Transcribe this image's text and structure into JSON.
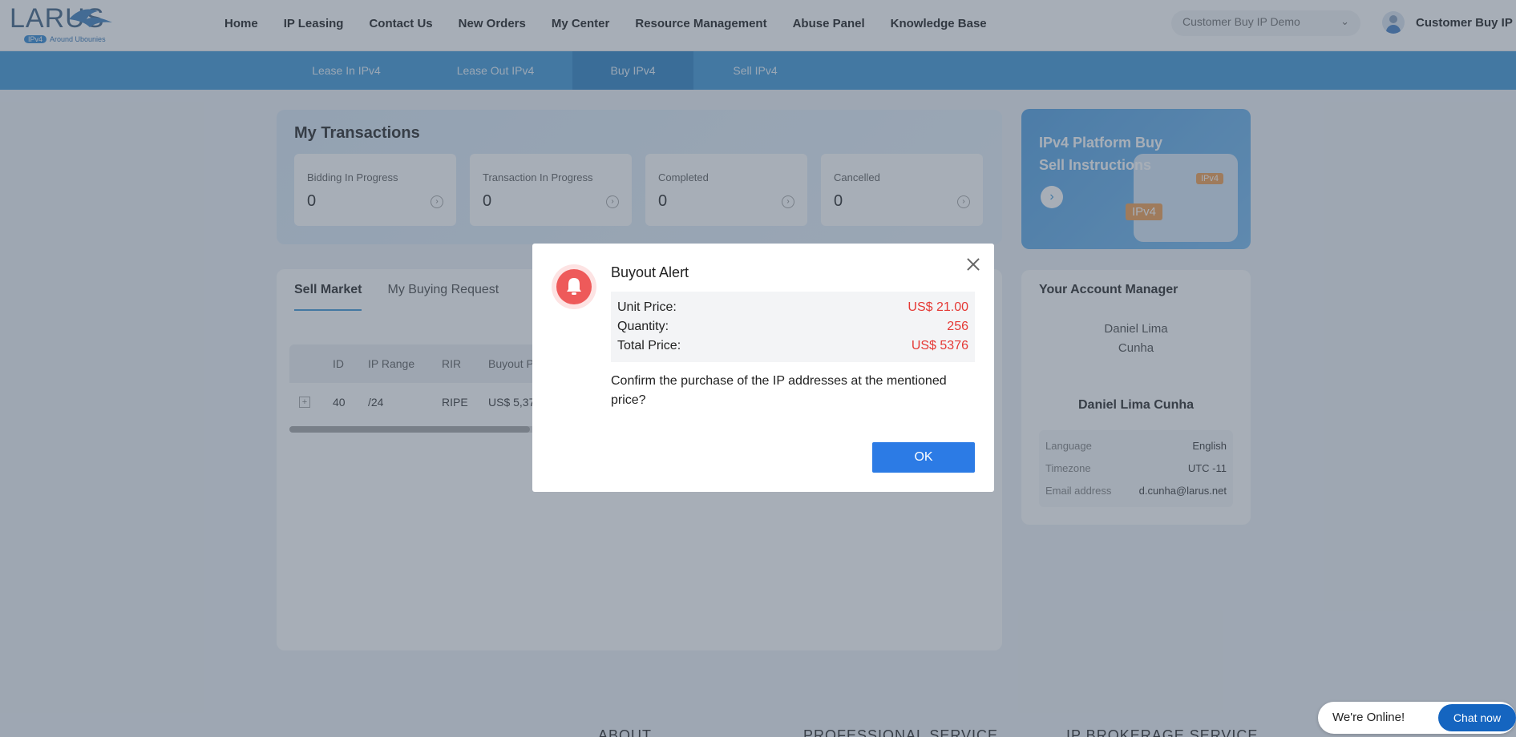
{
  "logo": {
    "text": "LARUS",
    "tag_badge": "IPv4",
    "tag_text": "Around Ubounies"
  },
  "nav": {
    "items": [
      "Home",
      "IP Leasing",
      "Contact Us",
      "New Orders",
      "My Center",
      "Resource Management",
      "Abuse Panel",
      "Knowledge Base"
    ]
  },
  "account_select": {
    "value": "Customer Buy IP Demo"
  },
  "user": {
    "name": "Customer Buy IP"
  },
  "subnav": {
    "items": [
      "Lease In IPv4",
      "Lease Out IPv4",
      "Buy IPv4",
      "Sell IPv4"
    ],
    "active": "Buy IPv4"
  },
  "transactions": {
    "title": "My Transactions",
    "boxes": [
      {
        "label": "Bidding In Progress",
        "value": "0"
      },
      {
        "label": "Transaction In Progress",
        "value": "0"
      },
      {
        "label": "Completed",
        "value": "0"
      },
      {
        "label": "Cancelled",
        "value": "0"
      }
    ]
  },
  "promo": {
    "title": "IPv4 Platform Buy Sell Instructions",
    "badge_small": "IPv4",
    "badge_large": "IPv4"
  },
  "market": {
    "tabs": [
      "Sell Market",
      "My Buying Request"
    ],
    "columns": [
      "ID",
      "IP Range",
      "RIR",
      "Buyout P"
    ],
    "rows": [
      {
        "id": "40",
        "range": "/24",
        "rir": "RIPE",
        "buyout": "US$ 5,37"
      }
    ]
  },
  "manager": {
    "title": "Your Account Manager",
    "photo_alt": "Daniel Lima Cunha",
    "name": "Daniel Lima Cunha",
    "rows": [
      {
        "key": "Language",
        "value": "English"
      },
      {
        "key": "Timezone",
        "value": "UTC -11"
      },
      {
        "key": "Email address",
        "value": "d.cunha@larus.net"
      }
    ]
  },
  "footer": {
    "cols": [
      "ABOUT",
      "PROFESSIONAL SERVICE",
      "IP BROKERAGE SERVICE"
    ]
  },
  "modal": {
    "title": "Buyout Alert",
    "unit_price_label": "Unit Price:",
    "unit_price": "US$ 21.00",
    "quantity_label": "Quantity:",
    "quantity": "256",
    "total_label": "Total Price:",
    "total": "US$ 5376",
    "message": "Confirm the purchase of the IP addresses at the mentioned price?",
    "ok": "OK"
  },
  "chat": {
    "status": "We're Online!",
    "button": "Chat now"
  }
}
